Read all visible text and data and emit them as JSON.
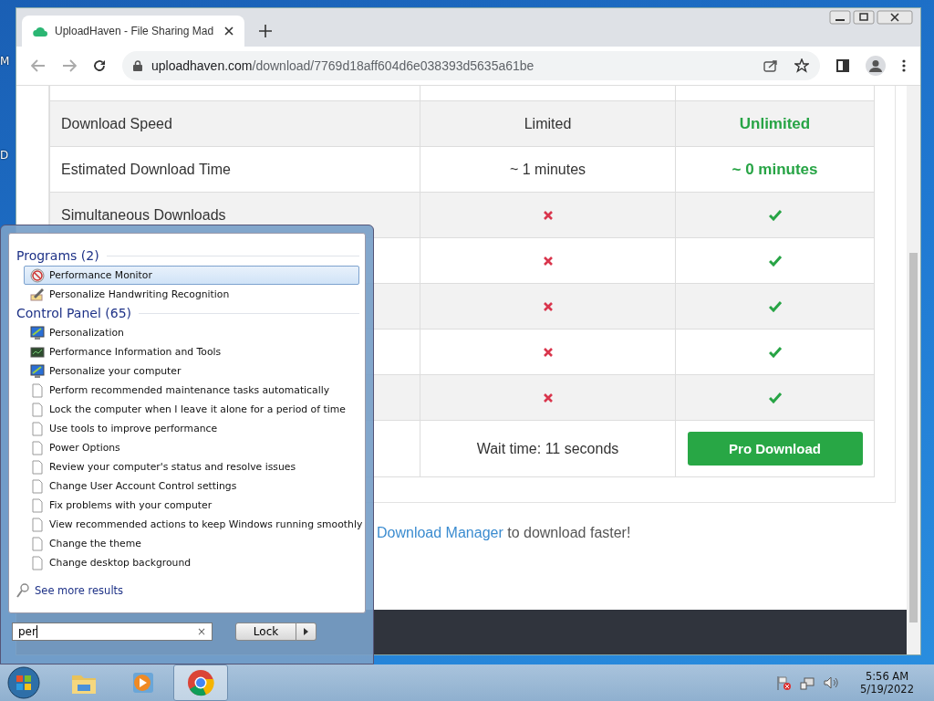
{
  "desktop": {
    "icon_labels": [
      "M",
      "D"
    ]
  },
  "browser": {
    "tabs": [
      {
        "title": "UploadHaven - File Sharing Mad",
        "selected": true
      }
    ],
    "address": {
      "domain": "uploadhaven.com",
      "path": "/download/7769d18aff604d6e038393d5635a61be"
    },
    "table": {
      "rows": [
        {
          "free": {
            "kind": "blank"
          },
          "pro": {
            "kind": "blank"
          }
        },
        {
          "label": "Download Speed",
          "free": {
            "kind": "text",
            "text": "Limited"
          },
          "pro": {
            "kind": "text",
            "text": "Unlimited"
          }
        },
        {
          "label": "Estimated Download Time",
          "free": {
            "kind": "text",
            "text": "~ 1 minutes"
          },
          "pro": {
            "kind": "text",
            "text": "~ 0 minutes"
          }
        },
        {
          "label": "Simultaneous Downloads",
          "free": {
            "kind": "cross"
          },
          "pro": {
            "kind": "check"
          }
        },
        {
          "free": {
            "kind": "cross"
          },
          "pro": {
            "kind": "check"
          }
        },
        {
          "free": {
            "kind": "cross"
          },
          "pro": {
            "kind": "check"
          }
        },
        {
          "free": {
            "kind": "cross"
          },
          "pro": {
            "kind": "check"
          }
        },
        {
          "free": {
            "kind": "cross"
          },
          "pro": {
            "kind": "check"
          }
        },
        {
          "free": {
            "kind": "text",
            "text": "Wait time: 11 seconds"
          },
          "pro": {
            "kind": "button",
            "text": "Pro Download"
          }
        }
      ]
    },
    "promo": {
      "link": "Download Manager",
      "text": "to download faster!"
    }
  },
  "start_menu": {
    "sections": [
      {
        "title": "Programs (2)",
        "items": [
          {
            "label": "Performance Monitor",
            "kind": "monitor",
            "selected": true
          },
          {
            "label": "Personalize Handwriting Recognition",
            "kind": "pen",
            "selected": false
          }
        ]
      },
      {
        "title": "Control Panel (65)",
        "items": [
          {
            "label": "Personalization",
            "kind": "screen",
            "selected": false
          },
          {
            "label": "Performance Information and Tools",
            "kind": "chip",
            "selected": false
          },
          {
            "label": "Personalize your computer",
            "kind": "screen",
            "selected": false
          },
          {
            "label": "Perform recommended maintenance tasks automatically",
            "kind": "doc",
            "selected": false
          },
          {
            "label": "Lock the computer when I leave it alone for a period of time",
            "kind": "doc",
            "selected": false
          },
          {
            "label": "Use tools to improve performance",
            "kind": "doc",
            "selected": false
          },
          {
            "label": "Power Options",
            "kind": "doc",
            "selected": false
          },
          {
            "label": "Review your computer's status and resolve issues",
            "kind": "doc",
            "selected": false
          },
          {
            "label": "Change User Account Control settings",
            "kind": "doc",
            "selected": false
          },
          {
            "label": "Fix problems with your computer",
            "kind": "doc",
            "selected": false
          },
          {
            "label": "View recommended actions to keep Windows running smoothly",
            "kind": "doc",
            "selected": false
          },
          {
            "label": "Change the theme",
            "kind": "doc",
            "selected": false
          },
          {
            "label": "Change desktop background",
            "kind": "doc",
            "selected": false
          }
        ]
      }
    ],
    "more": "See more results",
    "search": {
      "value": "per",
      "clear": "×"
    },
    "lock": "Lock"
  },
  "taskbar": {
    "apps": [
      {
        "kind": "explorer",
        "selected": false
      },
      {
        "kind": "media",
        "selected": false
      },
      {
        "kind": "chrome",
        "selected": true
      }
    ],
    "time": "5:56 AM",
    "date": "5/19/2022"
  }
}
